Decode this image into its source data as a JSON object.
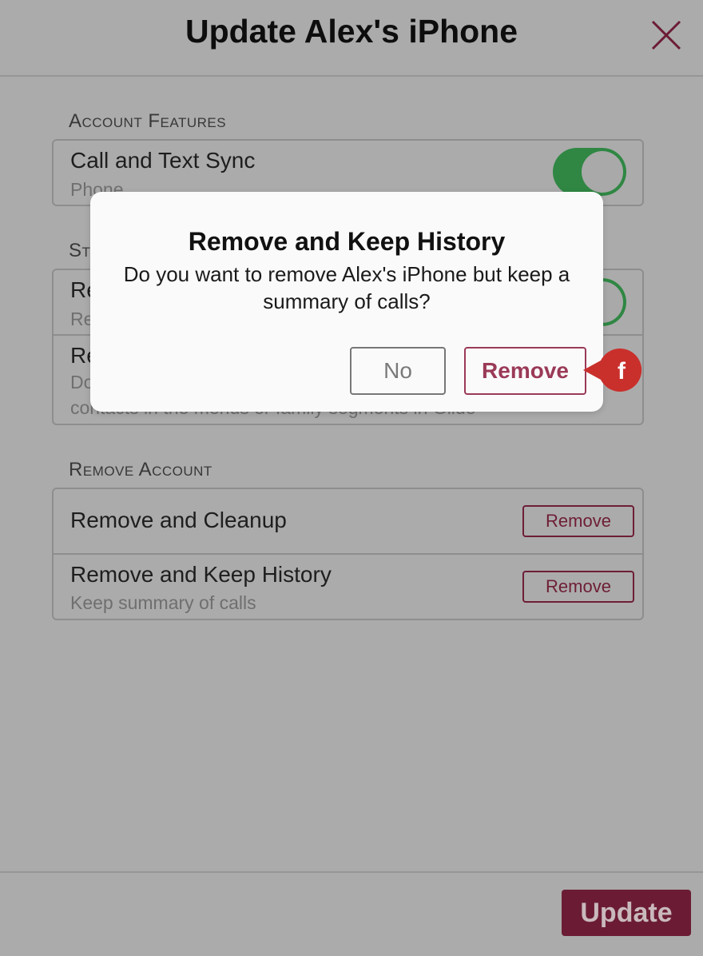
{
  "header": {
    "title": "Update Alex's iPhone"
  },
  "account_features": {
    "label": "Account Features",
    "rows": [
      {
        "title": "Call and Text Sync",
        "subtitle": "Phone",
        "toggle_on": true
      }
    ]
  },
  "second_section": {
    "label_visible": "St",
    "rows": [
      {
        "title_visible": "Re",
        "subtitle_visible": "Re",
        "toggle_on": true
      },
      {
        "title_visible": "Re",
        "subtitle_visible": "Do",
        "subtitle_line2_visible": "contacts in the menus or family segments in Glide"
      }
    ]
  },
  "remove_account": {
    "label": "Remove Account",
    "rows": [
      {
        "title": "Remove and Cleanup",
        "subtitle": "",
        "button_label": "Remove"
      },
      {
        "title": "Remove and Keep History",
        "subtitle": "Keep summary of calls",
        "button_label": "Remove"
      }
    ]
  },
  "footer": {
    "update_label": "Update"
  },
  "dialog": {
    "title": "Remove and Keep History",
    "message": "Do you want to remove Alex's iPhone but keep a summary of calls?",
    "no_label": "No",
    "remove_label": "Remove"
  },
  "marker": {
    "letter": "f"
  },
  "colors": {
    "brand": "#6b1c34",
    "dialog_accent": "#9a3a57",
    "toggle_on": "#2f8743",
    "marker": "#c9302c",
    "overlay_bg": "#ababab"
  }
}
